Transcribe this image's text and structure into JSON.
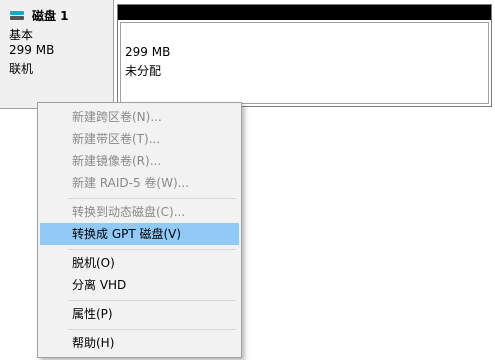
{
  "disk": {
    "name": "磁盘 1",
    "type": "基本",
    "size": "299 MB",
    "status": "联机",
    "icon": "disk-icon"
  },
  "partition": {
    "size": "299 MB",
    "status": "未分配"
  },
  "menu": {
    "items": [
      {
        "label": "新建跨区卷(N)...",
        "enabled": false
      },
      {
        "label": "新建带区卷(T)...",
        "enabled": false
      },
      {
        "label": "新建镜像卷(R)...",
        "enabled": false
      },
      {
        "label": "新建 RAID-5 卷(W)...",
        "enabled": false
      },
      {
        "label": "转换到动态磁盘(C)...",
        "enabled": false
      },
      {
        "label": "转换成 GPT 磁盘(V)",
        "enabled": true,
        "highlighted": true
      },
      {
        "label": "脱机(O)",
        "enabled": true
      },
      {
        "label": "分离 VHD",
        "enabled": true
      },
      {
        "label": "属性(P)",
        "enabled": true
      },
      {
        "label": "帮助(H)",
        "enabled": true
      }
    ]
  },
  "colors": {
    "highlight": "#91c9f7",
    "disabled_text": "#8a8a8a",
    "disk_icon": "#1aa8c8"
  }
}
